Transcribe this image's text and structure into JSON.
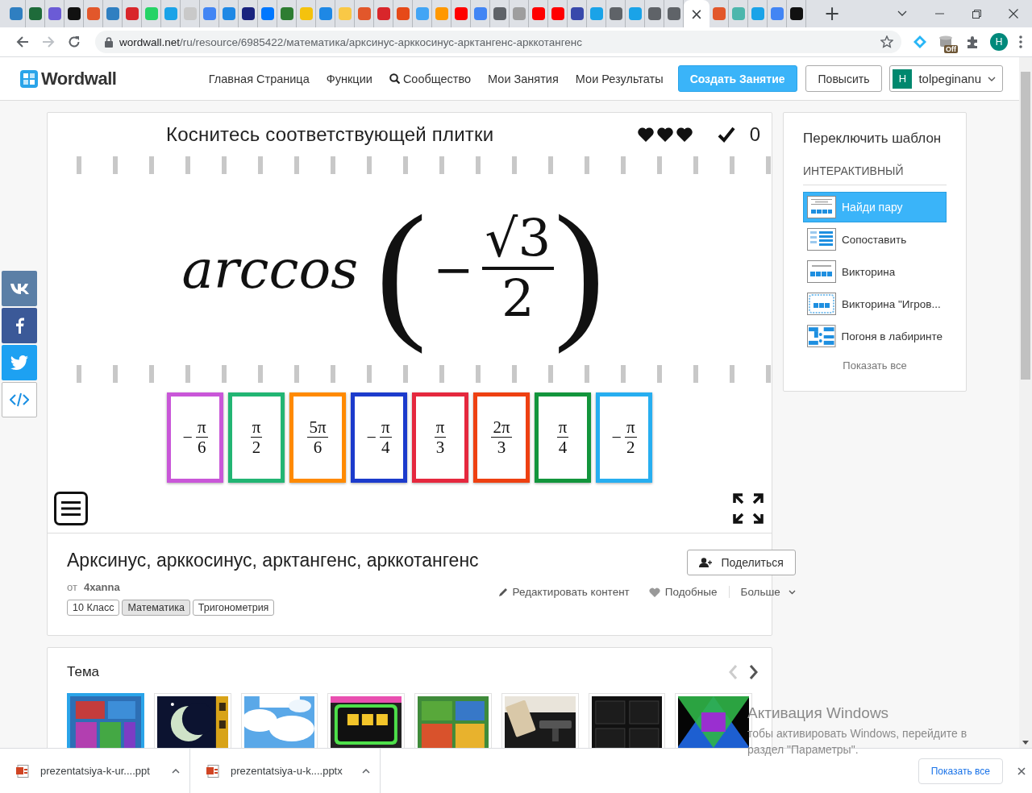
{
  "browser": {
    "tabs": [
      {
        "selected": false,
        "color": "#2f7fc1"
      },
      {
        "selected": false,
        "color": "#1e6b3a"
      },
      {
        "selected": false,
        "color": "#6b5bd6"
      },
      {
        "selected": false,
        "color": "#111111"
      },
      {
        "selected": false,
        "color": "#e2572b"
      },
      {
        "selected": false,
        "color": "#2f7fc1"
      },
      {
        "selected": false,
        "color": "#d8262b"
      },
      {
        "selected": false,
        "color": "#25d366"
      },
      {
        "selected": false,
        "color": "#1aa3e8"
      },
      {
        "selected": false,
        "color": "#c9c9c9"
      },
      {
        "selected": false,
        "color": "#4285f4"
      },
      {
        "selected": false,
        "color": "#1e88e5"
      },
      {
        "selected": false,
        "color": "#1a237e"
      },
      {
        "selected": false,
        "color": "#0077ff"
      },
      {
        "selected": false,
        "color": "#2e7d32"
      },
      {
        "selected": false,
        "color": "#f4c20d"
      },
      {
        "selected": false,
        "color": "#1e88e5"
      },
      {
        "selected": false,
        "color": "#f9c846"
      },
      {
        "selected": false,
        "color": "#e2572b"
      },
      {
        "selected": false,
        "color": "#d8262b"
      },
      {
        "selected": false,
        "color": "#e64a19"
      },
      {
        "selected": false,
        "color": "#42a5f5"
      },
      {
        "selected": false,
        "color": "#ff9800"
      },
      {
        "selected": false,
        "color": "#ff0000"
      },
      {
        "selected": false,
        "color": "#4285f4"
      },
      {
        "selected": false,
        "color": "#5f6368"
      },
      {
        "selected": false,
        "color": "#9e9e9e"
      },
      {
        "selected": false,
        "color": "#ff0000"
      },
      {
        "selected": false,
        "color": "#ff0000"
      },
      {
        "selected": false,
        "color": "#3949ab"
      },
      {
        "selected": false,
        "color": "#1aa3e8"
      },
      {
        "selected": false,
        "color": "#5f6368"
      },
      {
        "selected": false,
        "color": "#1aa3e8"
      },
      {
        "selected": false,
        "color": "#5f6368"
      },
      {
        "selected": false,
        "color": "#5f6368"
      },
      {
        "selected": true
      },
      {
        "selected": false,
        "color": "#e2572b"
      },
      {
        "selected": false,
        "color": "#4db6ac"
      },
      {
        "selected": false,
        "color": "#1aa3e8"
      },
      {
        "selected": false,
        "color": "#4285f4"
      },
      {
        "selected": false,
        "color": "#111111"
      }
    ],
    "close_tab": "×",
    "new_tab": "+",
    "url": {
      "host": "wordwall.net",
      "path": "/ru/resource/6985422/математика/арксинус-арккосинус-арктангенс-арккотангенс"
    },
    "extension_badge": "Off",
    "profile": "H"
  },
  "site_header": {
    "logo": "Wordwall",
    "nav": [
      {
        "label": "Главная Страница",
        "kind": "plain"
      },
      {
        "label": "Функции",
        "kind": "plain"
      },
      {
        "label": "Сообщество",
        "kind": "search"
      },
      {
        "label": "Мои Занятия",
        "kind": "plain"
      },
      {
        "label": "Мои Результаты",
        "kind": "plain"
      }
    ],
    "create_button": "Создать Занятие",
    "upgrade_button": "Повысить",
    "user": {
      "initial": "H",
      "name": "tolpeginanu"
    }
  },
  "game": {
    "instruction": "Коснитесь соответствующей плитки",
    "hearts": {
      "stars": 3
    },
    "score": "0",
    "question": {
      "function": "arccos",
      "open": "(",
      "sign": "−",
      "numerator": "√3",
      "denominator": "2",
      "close": ")"
    },
    "tiles": [
      {
        "sign": "−",
        "numerator": "π",
        "denominator": "6",
        "color": "#c957d8"
      },
      {
        "numerator": "π",
        "denominator": "2",
        "color": "#22b573"
      },
      {
        "numerator": "5π",
        "denominator": "6",
        "color": "#ff8a00"
      },
      {
        "sign": "−",
        "numerator": "π",
        "denominator": "4",
        "color": "#1c3bcc"
      },
      {
        "numerator": "π",
        "denominator": "3",
        "color": "#e5283e"
      },
      {
        "numerator": "2π",
        "denominator": "3",
        "color": "#ee4011"
      },
      {
        "numerator": "π",
        "denominator": "4",
        "color": "#12953c"
      },
      {
        "sign": "−",
        "numerator": "π",
        "denominator": "2",
        "color": "#27aef0"
      }
    ]
  },
  "activity": {
    "title": "Арксинус, арккосинус, арктангенс, арккотангенс",
    "by_label": "от",
    "author": "4xanna",
    "tags": [
      {
        "label": "10 Класс",
        "selected": false
      },
      {
        "label": "Математика",
        "selected": true
      },
      {
        "label": "Тригонометрия",
        "selected": false
      }
    ],
    "share_button": "Поделиться",
    "actions": [
      {
        "label": "Редактировать контент",
        "kind": "edit"
      },
      {
        "label": "Подобные",
        "kind": "like"
      },
      {
        "label": "Больше",
        "kind": "more"
      }
    ]
  },
  "template_panel": {
    "title": "Переключить шаблон",
    "section": "ИНТЕРАКТИВНЫЙ",
    "templates": [
      {
        "label": "Найди пару",
        "kind": "pairs",
        "selected": true
      },
      {
        "label": "Сопоставить",
        "kind": "match",
        "selected": false
      },
      {
        "label": "Викторина",
        "kind": "quiz",
        "selected": false
      },
      {
        "label": "Викторина \"Игров...",
        "kind": "gameshow",
        "selected": false
      },
      {
        "label": "Погоня в лабиринте",
        "kind": "maze",
        "selected": false
      }
    ],
    "show_all": "Показать все"
  },
  "theme": {
    "title": "Тема",
    "thumbnails": [
      {
        "kind": "picture",
        "selected": true
      },
      {
        "kind": "picture",
        "selected": false
      },
      {
        "kind": "picture",
        "selected": false
      },
      {
        "kind": "picture",
        "selected": false
      },
      {
        "kind": "picture",
        "selected": false
      },
      {
        "kind": "picture",
        "selected": false
      },
      {
        "kind": "picture",
        "selected": false
      },
      {
        "kind": "picture",
        "selected": false
      }
    ]
  },
  "social": [
    {
      "kind": "vk"
    },
    {
      "kind": "facebook"
    },
    {
      "kind": "twitter"
    },
    {
      "kind": "embed"
    }
  ],
  "downloads": {
    "files": [
      {
        "name": "prezentatsiya-k-ur....ppt"
      },
      {
        "name": "prezentatsiya-u-k....pptx"
      }
    ],
    "show_all": "Показать все"
  },
  "os_notice": {
    "title": "Активация Windows",
    "text": "тобы активировать Windows, перейдите в раздел \"Параметры\"."
  }
}
